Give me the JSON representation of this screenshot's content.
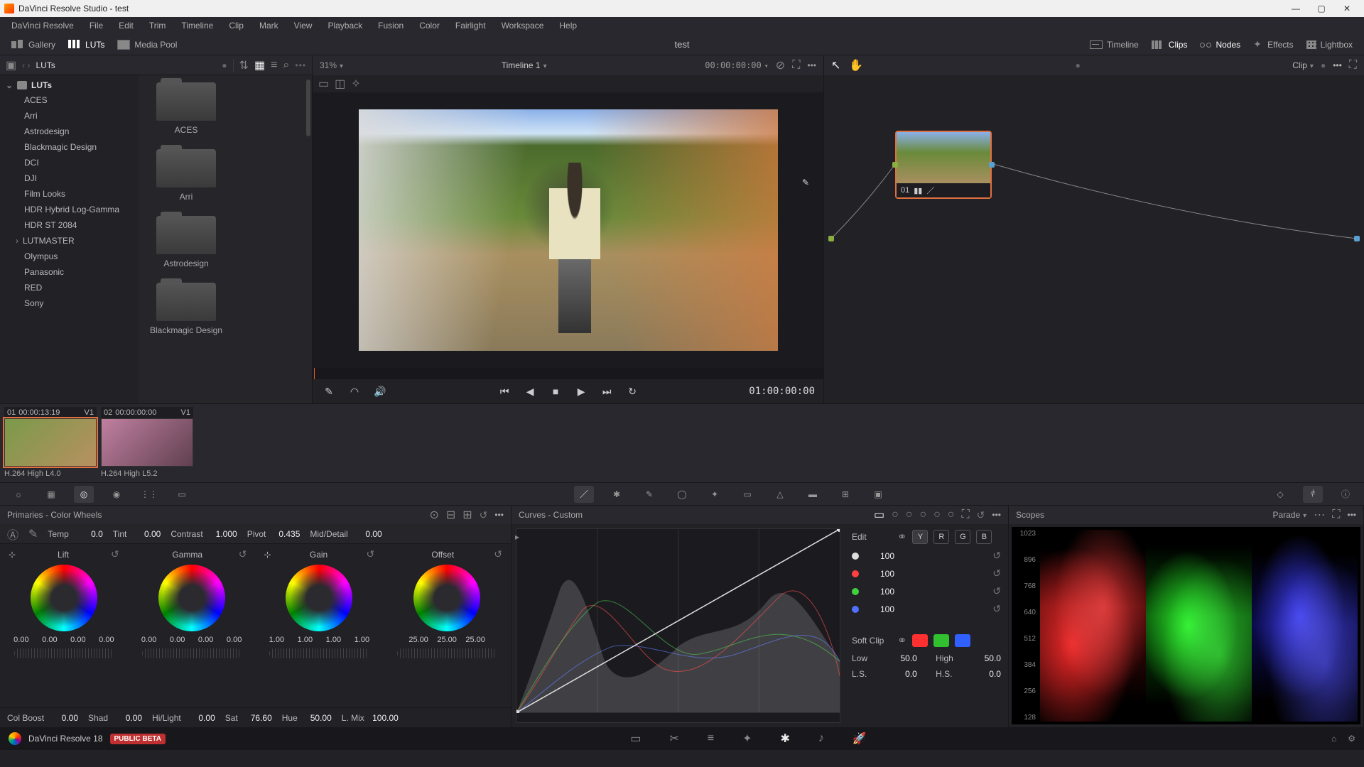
{
  "titlebar": {
    "text": "DaVinci Resolve Studio - test"
  },
  "menubar": [
    "DaVinci Resolve",
    "File",
    "Edit",
    "Trim",
    "Timeline",
    "Clip",
    "Mark",
    "View",
    "Playback",
    "Fusion",
    "Color",
    "Fairlight",
    "Workspace",
    "Help"
  ],
  "toolbar": {
    "gallery": "Gallery",
    "luts": "LUTs",
    "mediapool": "Media Pool",
    "title": "test",
    "timeline": "Timeline",
    "clips": "Clips",
    "nodes": "Nodes",
    "effects": "Effects",
    "lightbox": "Lightbox"
  },
  "luts": {
    "header": "LUTs",
    "root": "LUTs",
    "items": [
      "ACES",
      "Arri",
      "Astrodesign",
      "Blackmagic Design",
      "DCI",
      "DJI",
      "Film Looks",
      "HDR Hybrid Log-Gamma",
      "HDR ST 2084",
      "LUTMASTER",
      "Olympus",
      "Panasonic",
      "RED",
      "Sony"
    ],
    "expandable_index": 9,
    "folders": [
      "ACES",
      "Arri",
      "Astrodesign",
      "Blackmagic Design"
    ]
  },
  "viewer": {
    "zoom": "31%",
    "timeline_name": "Timeline 1",
    "src_tc": "00:00:00:00",
    "rec_tc": "01:00:00:00"
  },
  "nodes_panel": {
    "mode": "Clip",
    "node_label": "01"
  },
  "clips": [
    {
      "badge": "01",
      "tc": "00:00:13:19",
      "track": "V1",
      "label": "H.264 High L4.0"
    },
    {
      "badge": "02",
      "tc": "00:00:00:00",
      "track": "V1",
      "label": "H.264 High L5.2"
    }
  ],
  "primaries": {
    "title": "Primaries - Color Wheels",
    "params_top": [
      {
        "label": "Temp",
        "value": "0.0"
      },
      {
        "label": "Tint",
        "value": "0.00"
      },
      {
        "label": "Contrast",
        "value": "1.000"
      },
      {
        "label": "Pivot",
        "value": "0.435"
      },
      {
        "label": "Mid/Detail",
        "value": "0.00"
      }
    ],
    "wheels": [
      {
        "name": "Lift",
        "vals": [
          "0.00",
          "0.00",
          "0.00",
          "0.00"
        ]
      },
      {
        "name": "Gamma",
        "vals": [
          "0.00",
          "0.00",
          "0.00",
          "0.00"
        ]
      },
      {
        "name": "Gain",
        "vals": [
          "1.00",
          "1.00",
          "1.00",
          "1.00"
        ]
      },
      {
        "name": "Offset",
        "vals": [
          "25.00",
          "25.00",
          "25.00"
        ]
      }
    ],
    "params_bottom": [
      {
        "label": "Col Boost",
        "value": "0.00"
      },
      {
        "label": "Shad",
        "value": "0.00"
      },
      {
        "label": "Hi/Light",
        "value": "0.00"
      },
      {
        "label": "Sat",
        "value": "76.60"
      },
      {
        "label": "Hue",
        "value": "50.00"
      },
      {
        "label": "L. Mix",
        "value": "100.00"
      }
    ]
  },
  "curves": {
    "title": "Curves - Custom",
    "edit_label": "Edit",
    "channels": [
      "Y",
      "R",
      "G",
      "B"
    ],
    "intensity": [
      {
        "color": "#dddddd",
        "value": "100"
      },
      {
        "color": "#ff4040",
        "value": "100"
      },
      {
        "color": "#40d040",
        "value": "100"
      },
      {
        "color": "#5070ff",
        "value": "100"
      }
    ],
    "softclip": {
      "label": "Soft Clip",
      "swatches": [
        "#ff3030",
        "#30c030",
        "#3060ff"
      ],
      "low": {
        "label": "Low",
        "value": "50.0"
      },
      "high": {
        "label": "High",
        "value": "50.0"
      },
      "ls": {
        "label": "L.S.",
        "value": "0.0"
      },
      "hs": {
        "label": "H.S.",
        "value": "0.0"
      }
    }
  },
  "scopes": {
    "title": "Scopes",
    "mode": "Parade",
    "axis": [
      "1023",
      "896",
      "768",
      "640",
      "512",
      "384",
      "256",
      "128"
    ]
  },
  "pages": {
    "app": "DaVinci Resolve 18",
    "beta": "PUBLIC BETA"
  }
}
